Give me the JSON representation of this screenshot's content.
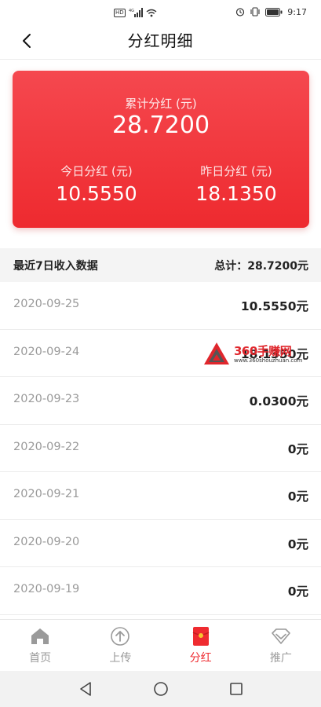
{
  "status_bar": {
    "hd_label": "HD",
    "network_label": "4G",
    "time": "9:17"
  },
  "nav": {
    "title": "分红明细"
  },
  "summary": {
    "total_label": "累计分红 (元)",
    "total_value": "28.7200",
    "today_label": "今日分红 (元)",
    "today_value": "10.5550",
    "yesterday_label": "昨日分红 (元)",
    "yesterday_value": "18.1350"
  },
  "list_header": {
    "title": "最近7日收入数据",
    "total": "总计：28.7200元"
  },
  "records": [
    {
      "date": "2020-09-25",
      "amount": "10.5550元"
    },
    {
      "date": "2020-09-24",
      "amount": "18.1350元"
    },
    {
      "date": "2020-09-23",
      "amount": "0.0300元"
    },
    {
      "date": "2020-09-22",
      "amount": "0元"
    },
    {
      "date": "2020-09-21",
      "amount": "0元"
    },
    {
      "date": "2020-09-20",
      "amount": "0元"
    },
    {
      "date": "2020-09-19",
      "amount": "0元"
    }
  ],
  "watermark": {
    "title": "360手赚网",
    "url": "www.360shouzhuan.com"
  },
  "tabs": [
    {
      "label": "首页",
      "icon": "home-icon",
      "active": false
    },
    {
      "label": "上传",
      "icon": "upload-icon",
      "active": false
    },
    {
      "label": "分红",
      "icon": "red-envelope-icon",
      "active": true
    },
    {
      "label": "推广",
      "icon": "diamond-icon",
      "active": false
    }
  ],
  "colors": {
    "accent": "#ef2b30",
    "card_top": "#f5484f",
    "card_bottom": "#ee2a2f",
    "muted_text": "#9a9a9a"
  }
}
